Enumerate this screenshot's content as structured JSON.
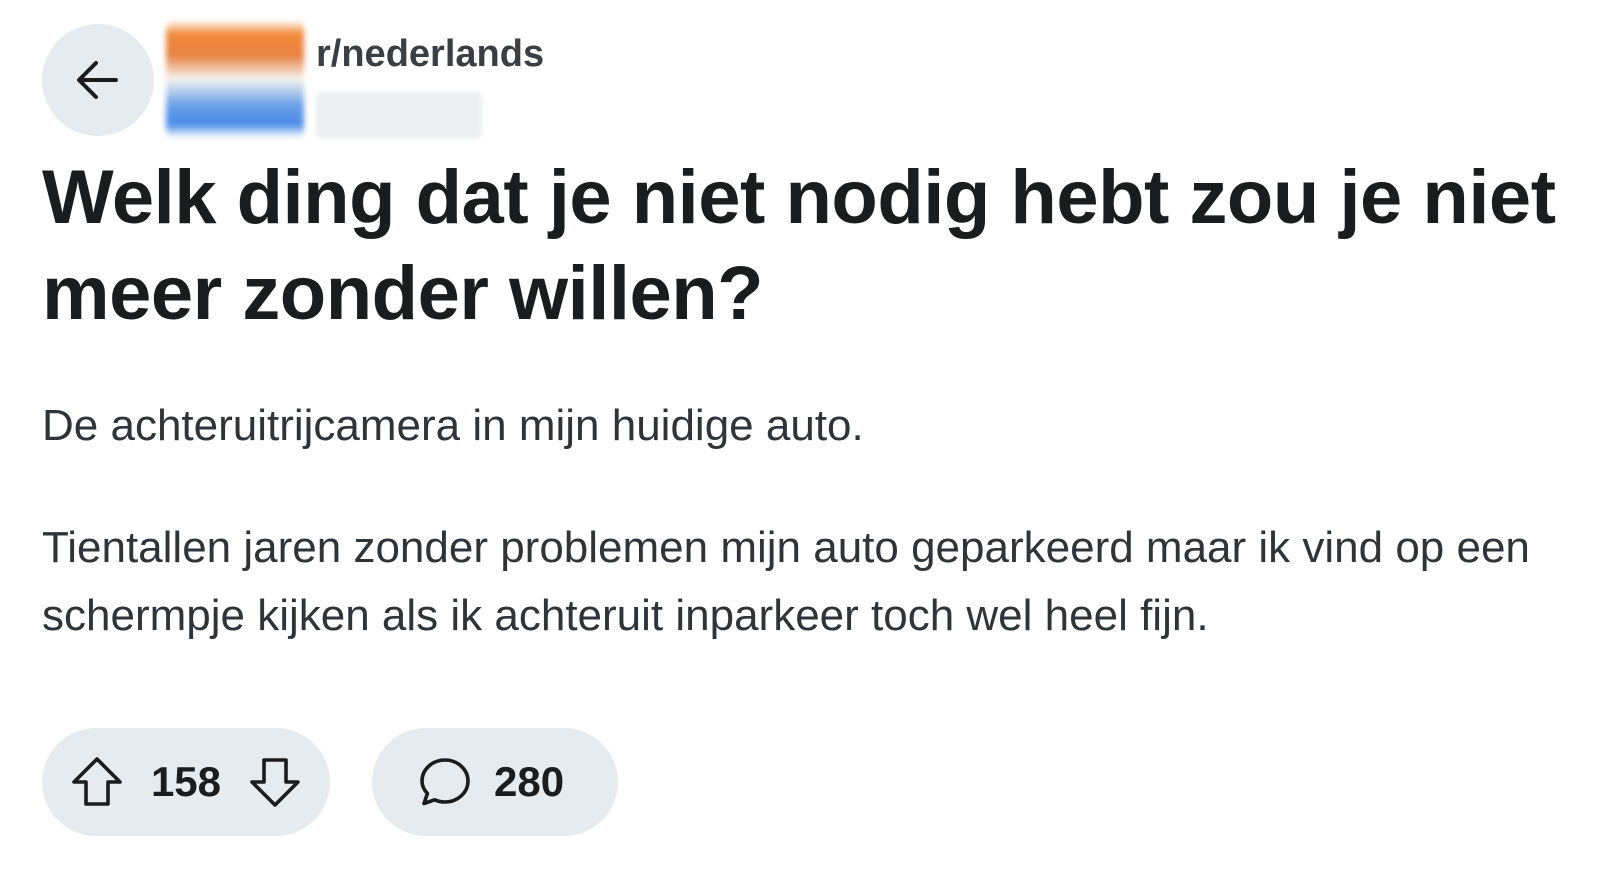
{
  "header": {
    "back_icon": "arrow-left-icon",
    "subreddit": "r/nederlands"
  },
  "post": {
    "title": "Welk ding dat je niet nodig hebt zou je niet meer zonder willen?",
    "body": [
      "De achteruitrijcamera in mijn huidige auto.",
      "Tientallen jaren zonder problemen mijn auto geparkeerd maar ik vind op een schermpje kijken als ik achteruit inparkeer toch wel heel fijn."
    ]
  },
  "actions": {
    "upvote_icon": "arrow-up-outline-icon",
    "vote_count": "158",
    "downvote_icon": "arrow-down-outline-icon",
    "comment_icon": "speech-bubble-icon",
    "comment_count": "280"
  },
  "colors": {
    "pill_background": "#e5ebee",
    "text_primary": "#1a1c1e",
    "text_body": "#2f3438"
  }
}
